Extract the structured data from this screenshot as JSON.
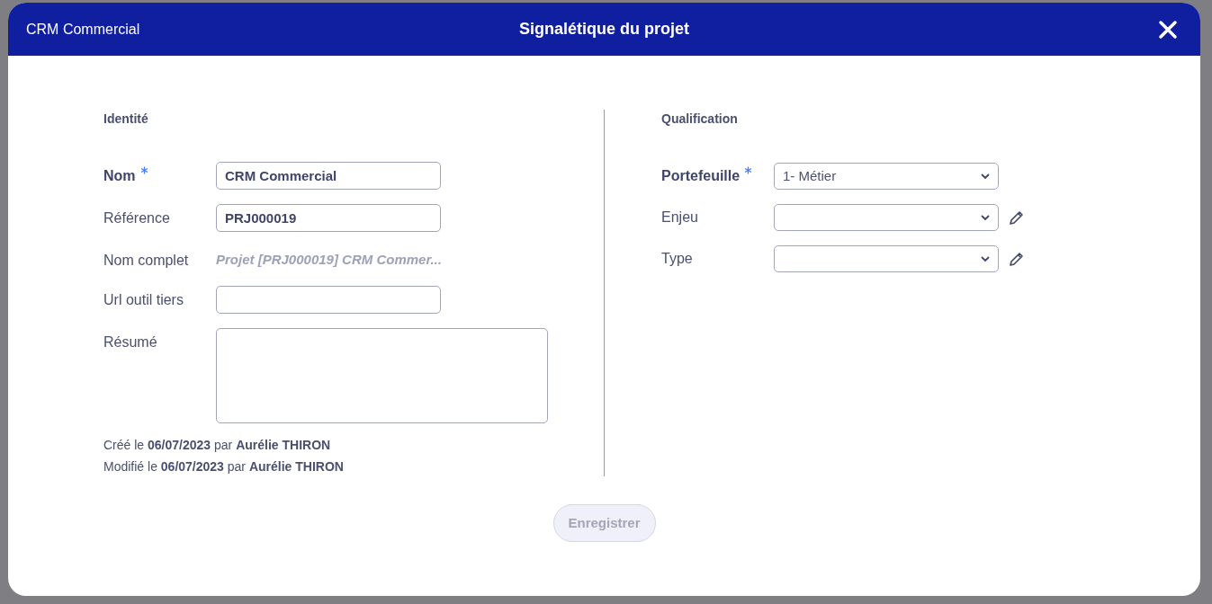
{
  "dialog": {
    "app_name": "CRM Commercial",
    "title": "Signalétique du projet",
    "identity": {
      "title": "Identité",
      "fields": [
        {
          "label": "Nom",
          "required": true,
          "kind": "input",
          "value": "CRM Commercial"
        },
        {
          "label": "Référence",
          "required": false,
          "kind": "input",
          "value": "PRJ000019"
        },
        {
          "label": "Nom complet",
          "required": false,
          "kind": "readonly",
          "value": "Projet [PRJ000019] CRM Commer..."
        },
        {
          "label": "Url outil tiers",
          "required": false,
          "kind": "input"
        },
        {
          "label": "Résumé",
          "required": false,
          "kind": "textarea"
        }
      ],
      "audit": [
        "Créé le **06/07/2023** par **Aurélie THIRON**",
        "Modifié le **06/07/2023** par **Aurélie THIRON**"
      ]
    },
    "qualification": {
      "title": "Qualification",
      "fields": [
        {
          "label": "Portefeuille",
          "required": true,
          "value": "1- Métier",
          "editable": false
        },
        {
          "label": "Enjeu",
          "required": false,
          "editable": true
        },
        {
          "label": "Type",
          "required": false,
          "editable": true
        }
      ]
    },
    "save_button": {
      "label": "Enregistrer",
      "disabled": true
    }
  }
}
